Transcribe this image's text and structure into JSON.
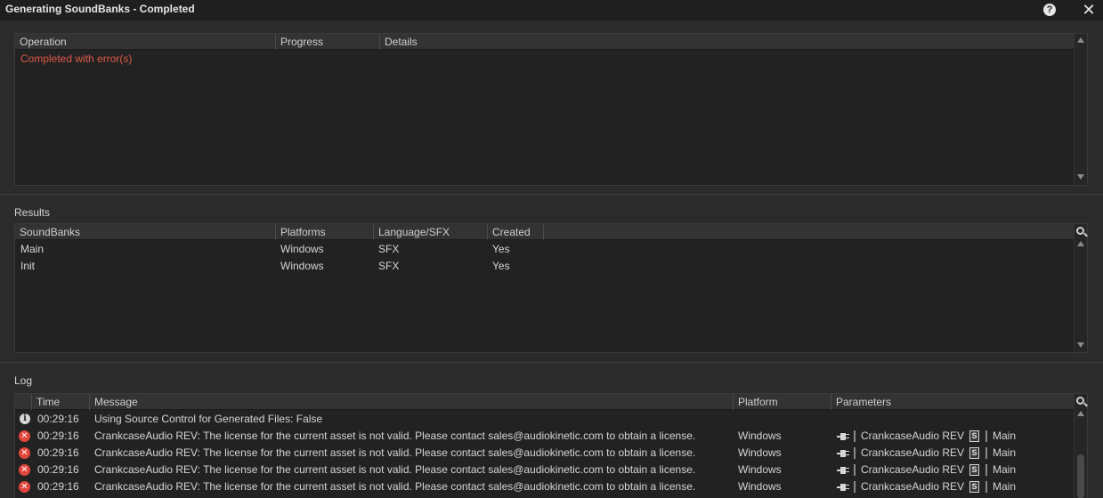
{
  "window": {
    "title": "Generating SoundBanks - Completed",
    "help_icon": "question-mark-icon",
    "close_icon": "close-icon"
  },
  "operations": {
    "columns": [
      "Operation",
      "Progress",
      "Details"
    ],
    "status": "Completed with error(s)",
    "status_color": "#e05a4a"
  },
  "results": {
    "label": "Results",
    "columns": [
      "SoundBanks",
      "Platforms",
      "Language/SFX",
      "Created"
    ],
    "rows": [
      {
        "soundbank": "Main",
        "platform": "Windows",
        "language": "SFX",
        "created": "Yes"
      },
      {
        "soundbank": "Init",
        "platform": "Windows",
        "language": "SFX",
        "created": "Yes"
      }
    ]
  },
  "log": {
    "label": "Log",
    "columns": [
      "Time",
      "Message",
      "Platform",
      "Parameters"
    ],
    "rows": [
      {
        "type": "info",
        "time": "00:29:16",
        "message": "Using Source Control for Generated Files: False",
        "platform": "",
        "param_object": "",
        "param_bank": ""
      },
      {
        "type": "error",
        "time": "00:29:16",
        "message": "CrankcaseAudio REV: The license for the current asset is not valid. Please contact sales@audiokinetic.com to obtain a license.",
        "platform": "Windows",
        "param_object": "CrankcaseAudio REV",
        "param_bank": "Main"
      },
      {
        "type": "error",
        "time": "00:29:16",
        "message": "CrankcaseAudio REV: The license for the current asset is not valid. Please contact sales@audiokinetic.com to obtain a license.",
        "platform": "Windows",
        "param_object": "CrankcaseAudio REV",
        "param_bank": "Main"
      },
      {
        "type": "error",
        "time": "00:29:16",
        "message": "CrankcaseAudio REV: The license for the current asset is not valid. Please contact sales@audiokinetic.com to obtain a license.",
        "platform": "Windows",
        "param_object": "CrankcaseAudio REV",
        "param_bank": "Main"
      },
      {
        "type": "error",
        "time": "00:29:16",
        "message": "CrankcaseAudio REV: The license for the current asset is not valid. Please contact sales@audiokinetic.com to obtain a license.",
        "platform": "Windows",
        "param_object": "CrankcaseAudio REV",
        "param_bank": "Main"
      }
    ],
    "icons": {
      "info": "info-icon",
      "error": "error-icon",
      "plugin": "plugin-icon",
      "soundbank": "soundbank-icon"
    }
  }
}
